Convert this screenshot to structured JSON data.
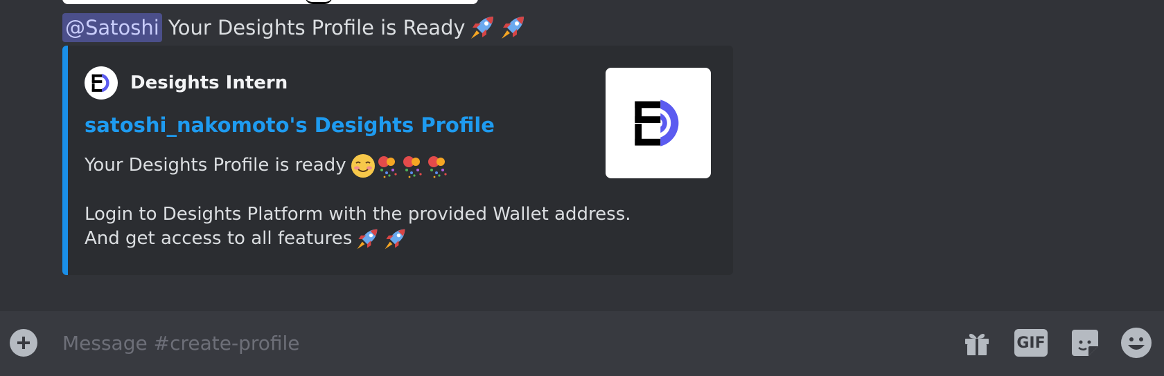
{
  "message": {
    "mention": "@Satoshi",
    "text": "Your Desights Profile is Ready"
  },
  "embed": {
    "author_name": "Desights Intern",
    "title": "satoshi_nakomoto's Desights Profile",
    "line1": "Your Desights Profile is ready",
    "line2": "Login to Desights Platform with the provided Wallet address.",
    "line3": "And get access to all features"
  },
  "composer": {
    "placeholder": "Message #create-profile",
    "gif_label": "GIF"
  },
  "colors": {
    "embed_accent": "#1a8fe8",
    "link": "#1e9bf0",
    "mention_bg": "#4b4f8a",
    "logo_purple": "#5b5bf0"
  },
  "icons": [
    "rocket-icon",
    "blush-smile-icon",
    "confetti-icon",
    "desights-logo",
    "plus-icon",
    "gift-icon",
    "gif-icon",
    "sticker-icon",
    "emoji-icon"
  ]
}
